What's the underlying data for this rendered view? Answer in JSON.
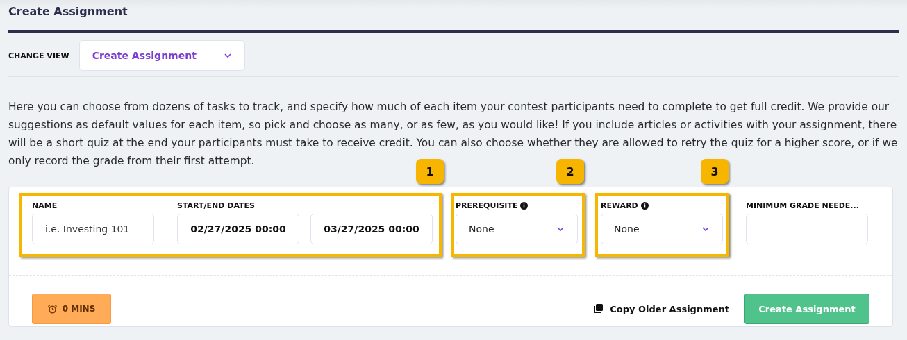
{
  "page_title": "Create Assignment",
  "view_selector": {
    "label": "CHANGE VIEW",
    "value": "Create Assignment"
  },
  "description": "Here you can choose from dozens of tasks to track, and specify how much of each item your contest participants need to complete to get full credit. We provide our suggestions as default values for each item, so pick and choose as many, or as few, as you would like! If you include articles or activities with your assignment, there will be a short quiz at the end your participants must take to receive credit. You can also choose whether they are allowed to retry the quiz for a higher score, or if we only record the grade from their first attempt.",
  "form": {
    "name": {
      "label": "NAME",
      "placeholder": "i.e. Investing 101"
    },
    "dates": {
      "label": "START/END DATES",
      "start": "02/27/2025 00:00",
      "end": "03/27/2025 00:00"
    },
    "prerequisite": {
      "label": "PREREQUISITE",
      "value": "None",
      "info": true
    },
    "reward": {
      "label": "REWARD",
      "value": "None",
      "info": true
    },
    "minimum_grade": {
      "label": "MINIMUM GRADE NEEDE..."
    }
  },
  "duration_badge": "0 MINS",
  "copy_link": "Copy Older Assignment",
  "submit_button": "Create Assignment",
  "annotations": [
    {
      "number": "1"
    },
    {
      "number": "2"
    },
    {
      "number": "3"
    }
  ]
}
